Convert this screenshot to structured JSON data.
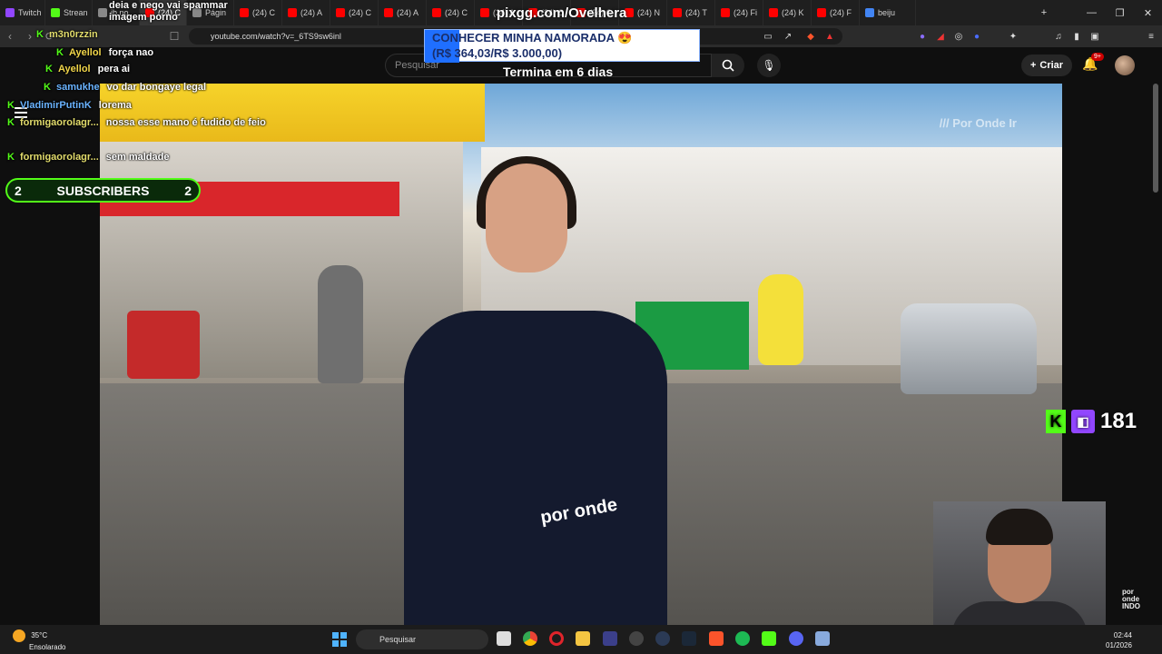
{
  "tabs": [
    {
      "label": "Twitch",
      "color": "#9146ff"
    },
    {
      "label": "Strean",
      "color": "#53fc18"
    },
    {
      "label": "ib no",
      "color": "#888888"
    },
    {
      "label": "(24) C",
      "color": "#ff0000"
    },
    {
      "label": "Págin",
      "color": "#888888"
    },
    {
      "label": "(24) C",
      "color": "#ff0000"
    },
    {
      "label": "(24) A",
      "color": "#ff0000"
    },
    {
      "label": "(24) C",
      "color": "#ff0000"
    },
    {
      "label": "(24) A",
      "color": "#ff0000"
    },
    {
      "label": "(24) C",
      "color": "#ff0000"
    },
    {
      "label": "(24) A",
      "color": "#ff0000"
    },
    {
      "label": "(24) C",
      "color": "#ff0000"
    },
    {
      "label": "(24) C",
      "color": "#ff0000"
    },
    {
      "label": "(24) N",
      "color": "#ff0000"
    },
    {
      "label": "(24) T",
      "color": "#ff0000"
    },
    {
      "label": "(24) Fi",
      "color": "#ff0000"
    },
    {
      "label": "(24) K",
      "color": "#ff0000"
    },
    {
      "label": "(24) F",
      "color": "#ff0000"
    },
    {
      "label": "beiju",
      "color": "#4285f4"
    }
  ],
  "address": {
    "url": "youtube.com/watch?v=_6TS9sw6inl"
  },
  "youtube": {
    "search_placeholder": "Pesquisar",
    "create_label": "Criar",
    "notif_badge": "9+"
  },
  "overlay": {
    "pix_url": "pixgg.com/Ovelhera",
    "goal_title": "CONHECER MINHA NAMORADA 😍",
    "goal_progress": "(R$ 364,03/R$ 3.000,00)",
    "goal_ends": "Termina em 6 dias",
    "subscribers_label": "SUBSCRIBERS",
    "subscribers_left": "2",
    "subscribers_right": "2",
    "viewer_count": "181",
    "watermark": "/// Por Onde Ir"
  },
  "chat": [
    {
      "user": "",
      "message": "deia e nego vai spammar imagem porno",
      "user_color": "yellow"
    },
    {
      "user": "m3n0rzzin",
      "message": "",
      "user_color": "green"
    },
    {
      "user": "Ayellol",
      "message": "força nao",
      "user_color": "yellow"
    },
    {
      "user": "Ayellol",
      "message": "pera ai",
      "user_color": "yellow"
    },
    {
      "user": "samukhe",
      "message": "vo dar bongaye legal",
      "user_color": "user"
    },
    {
      "user": "VladimirPutinK",
      "message": "lorema",
      "user_color": "user"
    },
    {
      "user": "formigaorolagr...",
      "message": "nossa esse mano é fudido de feio",
      "user_color": "green"
    },
    {
      "user": "formigaorolagr...",
      "message": "sem maldade",
      "user_color": "green"
    }
  ],
  "taskbar": {
    "temperature": "35°C",
    "weather": "Ensolarado",
    "search_label": "Pesquisar",
    "time": "02:44",
    "date": "01/2026"
  },
  "video": {
    "shirt_logo": "por onde"
  }
}
